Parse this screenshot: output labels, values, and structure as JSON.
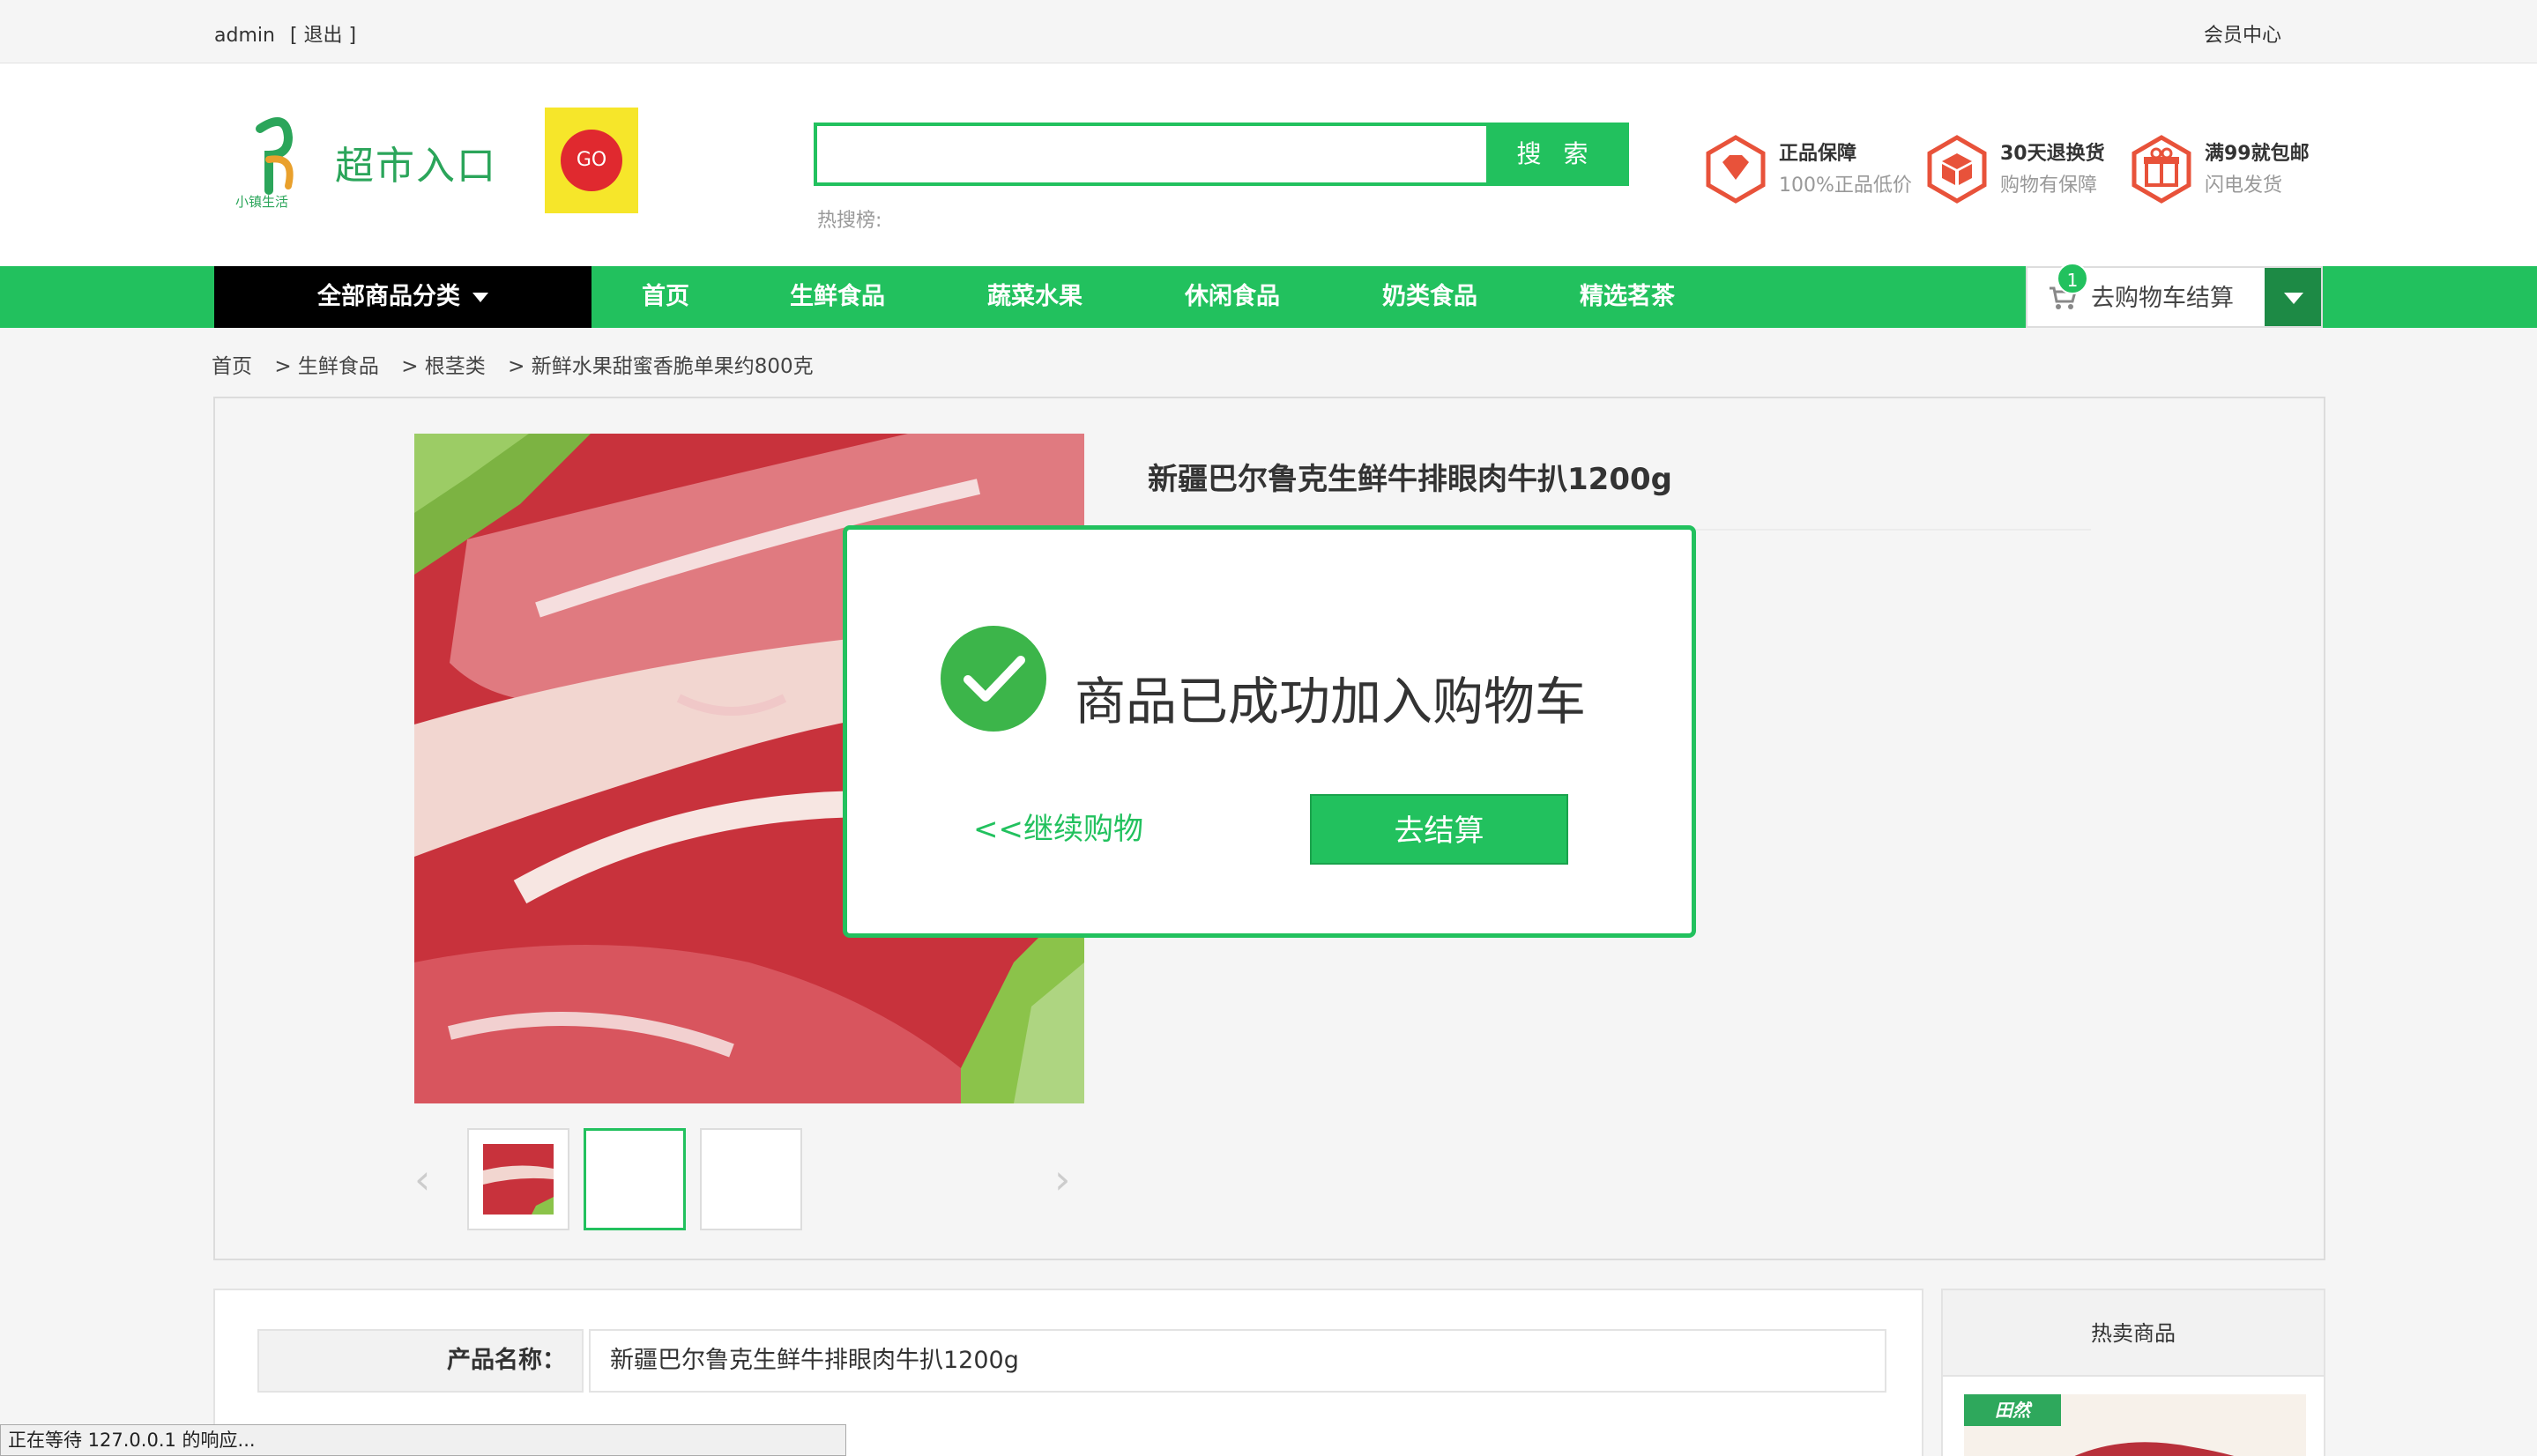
{
  "topbar": {
    "username": "admin",
    "logout": "[ 退出 ]",
    "member_center": "会员中心"
  },
  "header": {
    "logo_text": "超市入口",
    "logo_sub": "小镇生活",
    "logo_go": "GO",
    "search_placeholder": "",
    "search_button": "搜 索",
    "hot_search_label": "热搜榜:",
    "promos": [
      {
        "title": "正品保障",
        "sub": "100%正品低价",
        "icon": "diamond-icon"
      },
      {
        "title": "30天退换货",
        "sub": "购物有保障",
        "icon": "box-icon"
      },
      {
        "title": "满99就包邮",
        "sub": "闪电发货",
        "icon": "gift-icon"
      }
    ]
  },
  "nav": {
    "all_categories": "全部商品分类",
    "items": [
      "首页",
      "生鲜食品",
      "蔬菜水果",
      "休闲食品",
      "奶类食品",
      "精选茗茶"
    ],
    "cart_label": "去购物车结算",
    "cart_count": "1"
  },
  "breadcrumb": [
    "首页",
    "> 生鲜食品",
    "> 根茎类",
    "> 新鲜水果甜蜜香脆单果约800克"
  ],
  "product": {
    "title": "新疆巴尔鲁克生鲜牛排眼肉牛扒1200g",
    "detail_label": "产品名称：",
    "detail_value": "新疆巴尔鲁克生鲜牛排眼肉牛扒1200g"
  },
  "modal": {
    "message": "商品已成功加入购物车",
    "continue": "<<继续购物",
    "checkout": "去结算"
  },
  "sidebar": {
    "hot_title": "热卖商品",
    "hot_badge": "田然"
  },
  "status": {
    "text": "正在等待 127.0.0.1 的响应..."
  },
  "colors": {
    "accent": "#22c15e",
    "nav_black": "#000000",
    "promo_orange": "#e8523a"
  }
}
